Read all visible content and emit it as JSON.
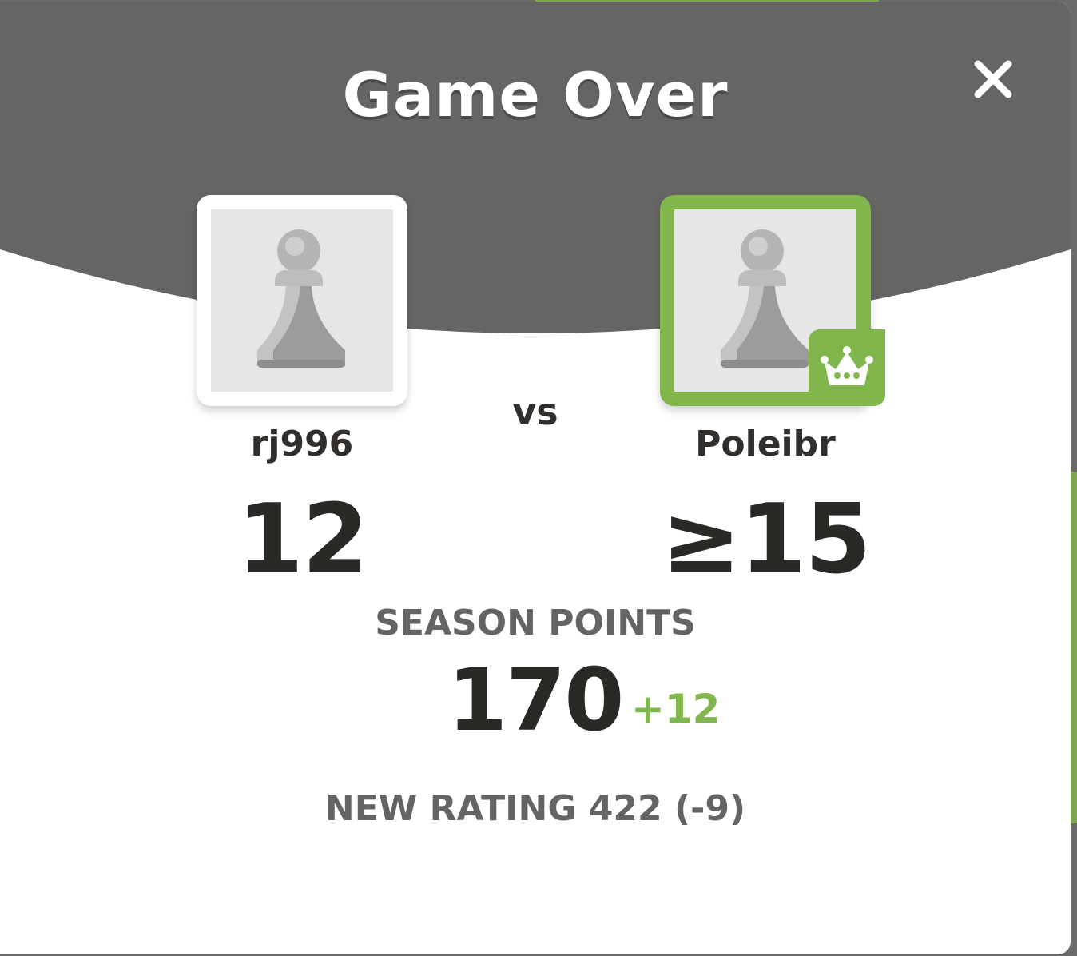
{
  "modal": {
    "title": "Game Over",
    "close_icon": "close-icon"
  },
  "players": {
    "left": {
      "name": "rj996",
      "score": "12",
      "avatar_icon": "pawn-icon"
    },
    "right": {
      "name": "Poleibr",
      "score": "≥15",
      "avatar_icon": "pawn-icon",
      "badge_icon": "crown-icon",
      "winner": true
    },
    "vs_label": "vs"
  },
  "season": {
    "label": "SEASON POINTS",
    "value": "170",
    "delta": "+12"
  },
  "rating": {
    "text": "NEW RATING 422 (-9)"
  },
  "colors": {
    "header": "#666564",
    "accent_green": "#81b64c",
    "text_dark": "#2b2926",
    "text_muted": "#666463"
  }
}
